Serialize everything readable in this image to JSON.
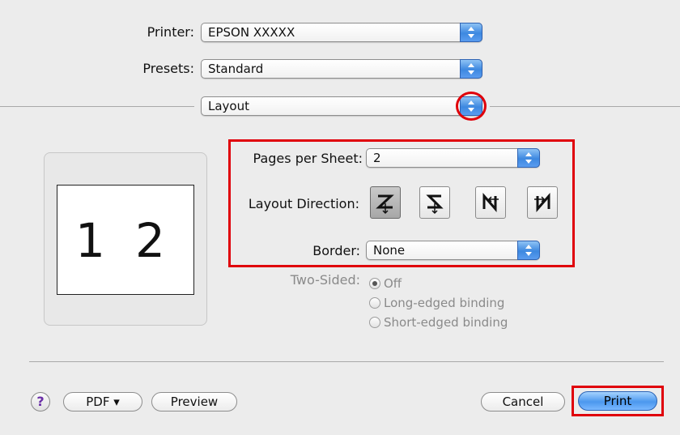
{
  "printer": {
    "label": "Printer:",
    "value": "EPSON XXXXX"
  },
  "presets": {
    "label": "Presets:",
    "value": "Standard"
  },
  "panel": {
    "value": "Layout"
  },
  "preview": {
    "page1": "1",
    "page2": "2"
  },
  "pages_per_sheet": {
    "label": "Pages per Sheet:",
    "value": "2"
  },
  "layout_direction": {
    "label": "Layout Direction:",
    "options": [
      "z-left-right",
      "reverse-z",
      "n-top-bottom",
      "reverse-n"
    ],
    "selected_index": 0
  },
  "border": {
    "label": "Border:",
    "value": "None"
  },
  "two_sided": {
    "label": "Two-Sided:",
    "options": [
      "Off",
      "Long-edged binding",
      "Short-edged binding"
    ],
    "selected": "Off"
  },
  "footer": {
    "help_glyph": "?",
    "pdf_label": "PDF ▾",
    "preview_label": "Preview",
    "cancel_label": "Cancel",
    "print_label": "Print"
  },
  "colors": {
    "highlight": "#e0000a",
    "accent": "#4b98ee"
  }
}
